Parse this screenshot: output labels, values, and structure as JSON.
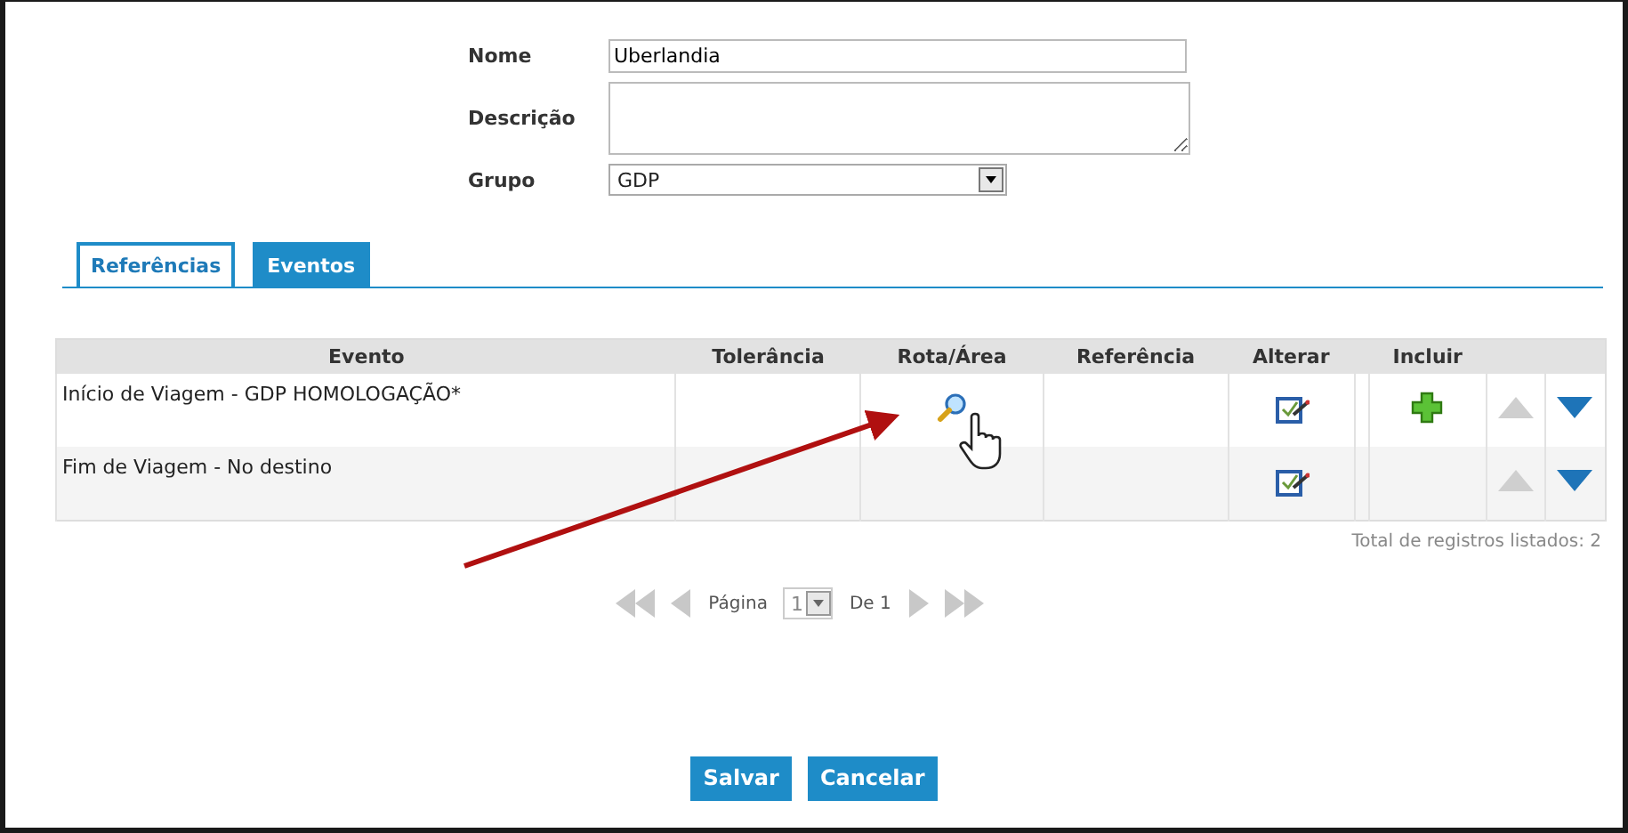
{
  "form": {
    "fields": [
      {
        "label": "Nome",
        "kind": "text",
        "value": "Uberlandia"
      },
      {
        "label": "Descrição",
        "kind": "textarea"
      },
      {
        "label": "Grupo",
        "kind": "select",
        "value": "GDP"
      }
    ]
  },
  "tabs": [
    {
      "label": "Referências",
      "selected": false
    },
    {
      "label": "Eventos",
      "selected": true
    }
  ],
  "table": {
    "columns": [
      "Evento",
      "Tolerância",
      "Rota/Área",
      "Referência",
      "Alterar",
      "Incluir"
    ],
    "rows": [
      {
        "evento": "Início de Viagem - GDP HOMOLOGAÇÃO*",
        "has_route": true,
        "has_include": true,
        "up_disabled": true,
        "down_disabled": false
      },
      {
        "evento": "Fim de Viagem - No destino",
        "has_route": false,
        "has_include": false,
        "up_disabled": true,
        "down_disabled": false
      }
    ]
  },
  "total": "Total de registros listados: 2",
  "pager": {
    "page_label": "Página",
    "page": "1",
    "of_label": "De 1"
  },
  "buttons": [
    "Salvar",
    "Cancelar"
  ]
}
